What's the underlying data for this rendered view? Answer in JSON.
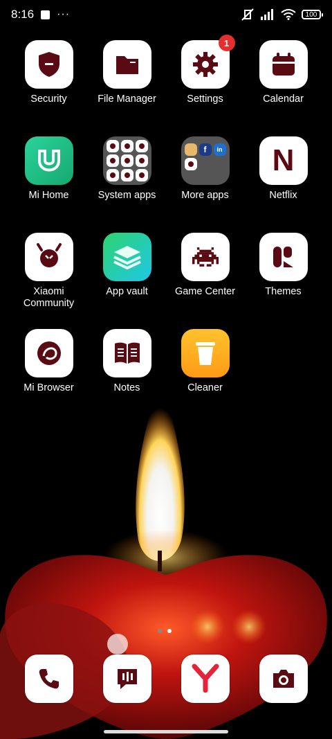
{
  "status_bar": {
    "time": "8:16",
    "battery": "100"
  },
  "apps": [
    [
      {
        "label": "Security"
      },
      {
        "label": "File Manager"
      },
      {
        "label": "Settings",
        "badge": "1"
      },
      {
        "label": "Calendar"
      }
    ],
    [
      {
        "label": "Mi Home"
      },
      {
        "label": "System apps"
      },
      {
        "label": "More apps"
      },
      {
        "label": "Netflix"
      }
    ],
    [
      {
        "label": "Xiaomi Community"
      },
      {
        "label": "App vault"
      },
      {
        "label": "Game Center"
      },
      {
        "label": "Themes"
      }
    ],
    [
      {
        "label": "Mi Browser"
      },
      {
        "label": "Notes"
      },
      {
        "label": "Cleaner"
      }
    ]
  ],
  "netflix_letter": "N",
  "dock": [
    "Phone",
    "Messages",
    "Yandex Browser",
    "Camera"
  ],
  "colors": {
    "icon_glyph": "#5a0a12",
    "badge": "#e52e2e"
  }
}
